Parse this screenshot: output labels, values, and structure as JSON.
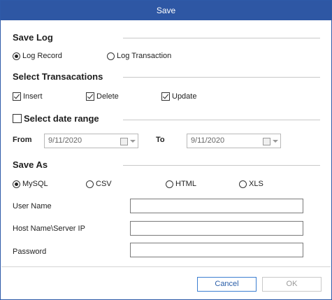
{
  "dialog": {
    "title": "Save"
  },
  "save_log": {
    "heading": "Save Log",
    "options": [
      {
        "label": "Log Record",
        "selected": true
      },
      {
        "label": "Log Transaction",
        "selected": false
      }
    ]
  },
  "transactions": {
    "heading": "Select Transacations",
    "options": [
      {
        "label": "Insert",
        "checked": true
      },
      {
        "label": "Delete",
        "checked": true
      },
      {
        "label": "Update",
        "checked": true
      }
    ]
  },
  "date_range": {
    "label": "Select date range",
    "checked": false,
    "from_label": "From",
    "from_value": "9/11/2020",
    "to_label": "To",
    "to_value": "9/11/2020"
  },
  "save_as": {
    "heading": "Save As",
    "options": [
      {
        "label": "MySQL",
        "selected": true
      },
      {
        "label": "CSV",
        "selected": false
      },
      {
        "label": "HTML",
        "selected": false
      },
      {
        "label": "XLS",
        "selected": false
      }
    ]
  },
  "fields": {
    "user_name_label": "User Name",
    "user_name_value": "",
    "host_label": "Host Name\\Server IP",
    "host_value": "",
    "password_label": "Password",
    "password_value": ""
  },
  "buttons": {
    "cancel": "Cancel",
    "ok": "OK"
  }
}
